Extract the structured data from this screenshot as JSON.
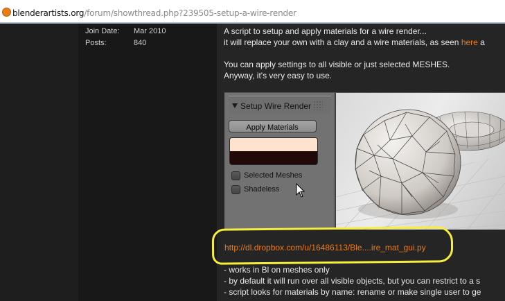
{
  "address_bar": {
    "domain": "blenderartists.org",
    "path": "/forum/showthread.php?239505-setup-a-wire-render"
  },
  "user_meta": {
    "join_label": "Join Date:",
    "join_value": "Mar 2010",
    "posts_label": "Posts:",
    "posts_value": "840"
  },
  "post": {
    "line1": "A script to setup and apply materials for a wire render...",
    "line2_prefix": "it will replace your own with a clay and a wire materials, as seen ",
    "line2_link": "here",
    "line2_suffix": " a",
    "line3": "You can apply settings to all visible or just selected MESHES.",
    "line4": "Anyway, it's very easy to use."
  },
  "panel": {
    "title": "Setup Wire Render",
    "apply_button": "Apply Materials",
    "swatch_top_color": "#ffe3cf",
    "swatch_bottom_color": "#220909",
    "checkbox_selected_label": "Selected Meshes",
    "checkbox_shadeless_label": "Shadeless"
  },
  "download_link": "http://dl.dropbox.com/u/16486113/Ble....ire_mat_gui.py",
  "bullets": [
    "- works in Bl on meshes only",
    "- by default it will run over all visible objects, but you can restrict to a s",
    "- script looks for materials by name: rename or make single user to ge"
  ],
  "colors": {
    "link": "#ee7a18",
    "highlight": "#f7ee3a"
  }
}
